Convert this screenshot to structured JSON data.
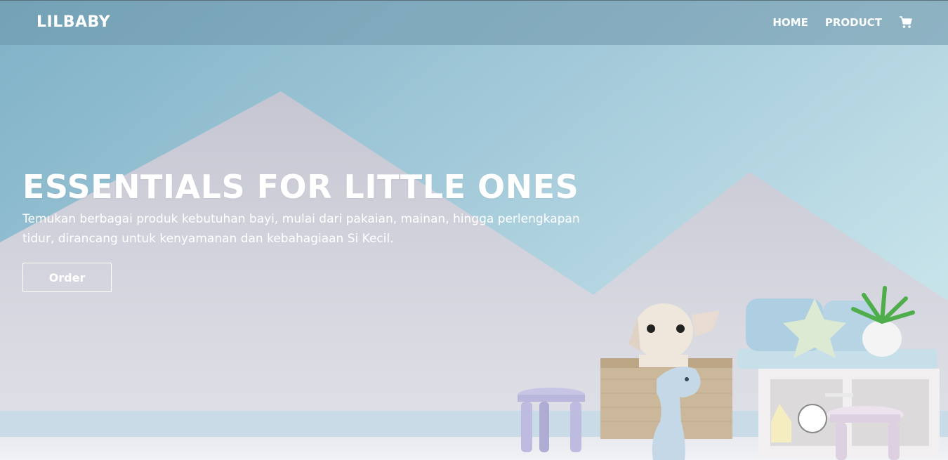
{
  "navbar": {
    "brand": "LILBABY",
    "links": [
      {
        "label": "HOME"
      },
      {
        "label": "PRODUCT"
      }
    ],
    "cart_icon": "shopping-cart-icon"
  },
  "hero": {
    "title": "ESSENTIALS FOR LITTLE ONES",
    "subtitle": "Temukan berbagai produk kebutuhan bayi, mulai dari pakaian, mainan, hingga perlengkapan tidur, dirancang untuk kenyamanan dan kebahagiaan Si Kecil.",
    "cta_label": "Order"
  },
  "colors": {
    "sky_blue": "#8fbfd2",
    "mountain_grey": "#dcdde4",
    "text": "#ffffff"
  }
}
